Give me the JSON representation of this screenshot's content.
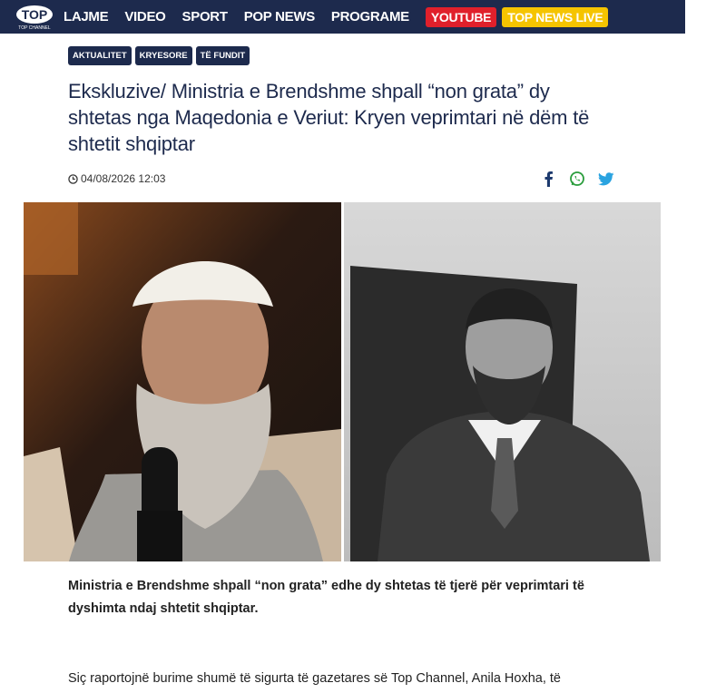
{
  "header": {
    "logo_alt": "TOP CHANNEL",
    "nav": [
      {
        "label": "LAJME"
      },
      {
        "label": "VIDEO"
      },
      {
        "label": "SPORT"
      },
      {
        "label": "POP NEWS"
      },
      {
        "label": "PROGRAME"
      }
    ],
    "youtube_label": "YOUTUBE",
    "live_label": "TOP NEWS LIVE",
    "colors": {
      "bar": "#1d2a4d",
      "youtube": "#e0202b",
      "live": "#f5c400"
    }
  },
  "article": {
    "tags": [
      "AKTUALITET",
      "KRYESORE",
      "TË FUNDIT"
    ],
    "title": "Ekskluzive/ Ministria e Brendshme shpall “non grata” dy shtetas nga Maqedonia e Veriut: Kryen veprimtari në dëm të shtetit shqiptar",
    "datetime": "04/08/2026 12:03",
    "share": [
      "facebook-icon",
      "whatsapp-icon",
      "twitter-icon"
    ],
    "lead": "Ministria e Brendshme shpall “non grata” edhe dy shtetas të tjerë për veprimtari të dyshimta ndaj shtetit shqiptar.",
    "body_first_line": "Siç raportojnë burime shumë të sigurta të gazetares së Top Channel, Anila Hoxha, të"
  }
}
